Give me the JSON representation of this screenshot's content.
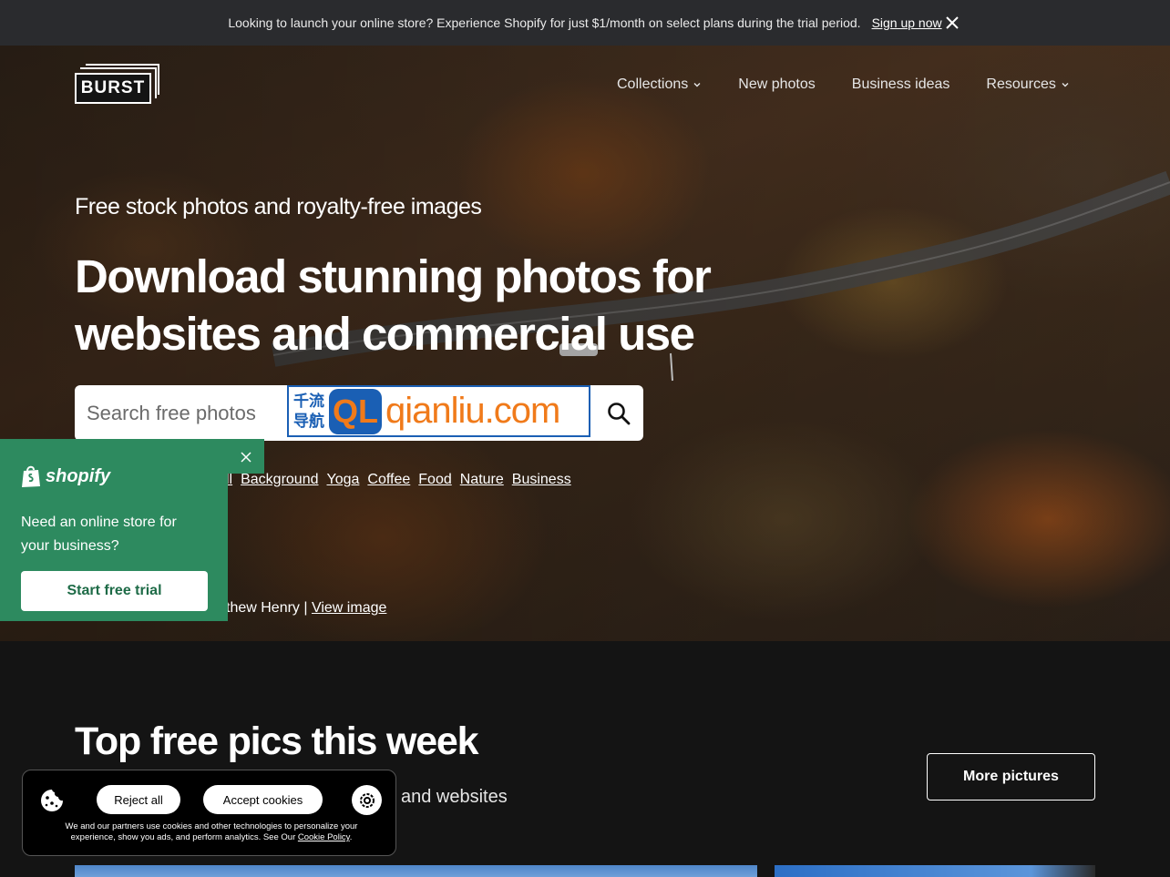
{
  "announcement": {
    "message": "Looking to launch your online store? Experience Shopify for just $1/month on select plans during the trial period.",
    "link": "Sign up now"
  },
  "header": {
    "logo": "BURST",
    "nav": [
      {
        "label": "Collections",
        "has_dropdown": true
      },
      {
        "label": "New photos",
        "has_dropdown": false
      },
      {
        "label": "Business ideas",
        "has_dropdown": false
      },
      {
        "label": "Resources",
        "has_dropdown": true
      }
    ]
  },
  "hero": {
    "tagline": "Free stock photos and royalty-free images",
    "headline": "Download stunning photos for websites and commercial use",
    "search_placeholder": "Search free photos",
    "watermark": {
      "cn_top": "千流",
      "cn_bottom": "导航",
      "ql": "QL",
      "domain": "qianliu.com"
    },
    "tags": [
      "ll",
      "Background",
      "Yoga",
      "Coffee",
      "Food",
      "Nature",
      "Business"
    ],
    "credit_prefix": "thew Henry | ",
    "credit_link": "View image"
  },
  "promo": {
    "brand": "shopify",
    "text": "Need an online store for your business?",
    "cta": "Start free trial"
  },
  "section": {
    "title": "Top free pics this week",
    "subtitle": "and websites",
    "more_button": "More pictures"
  },
  "cookie": {
    "reject": "Reject all",
    "accept": "Accept cookies",
    "text": "We and our partners use cookies and other technologies to personalize your experience, show you ads, and perform analytics. See Our",
    "policy_link": "Cookie Policy"
  },
  "colors": {
    "announce_bg": "#2a2b2e",
    "promo_green": "#2d8a5f",
    "page_bg": "#141414"
  }
}
